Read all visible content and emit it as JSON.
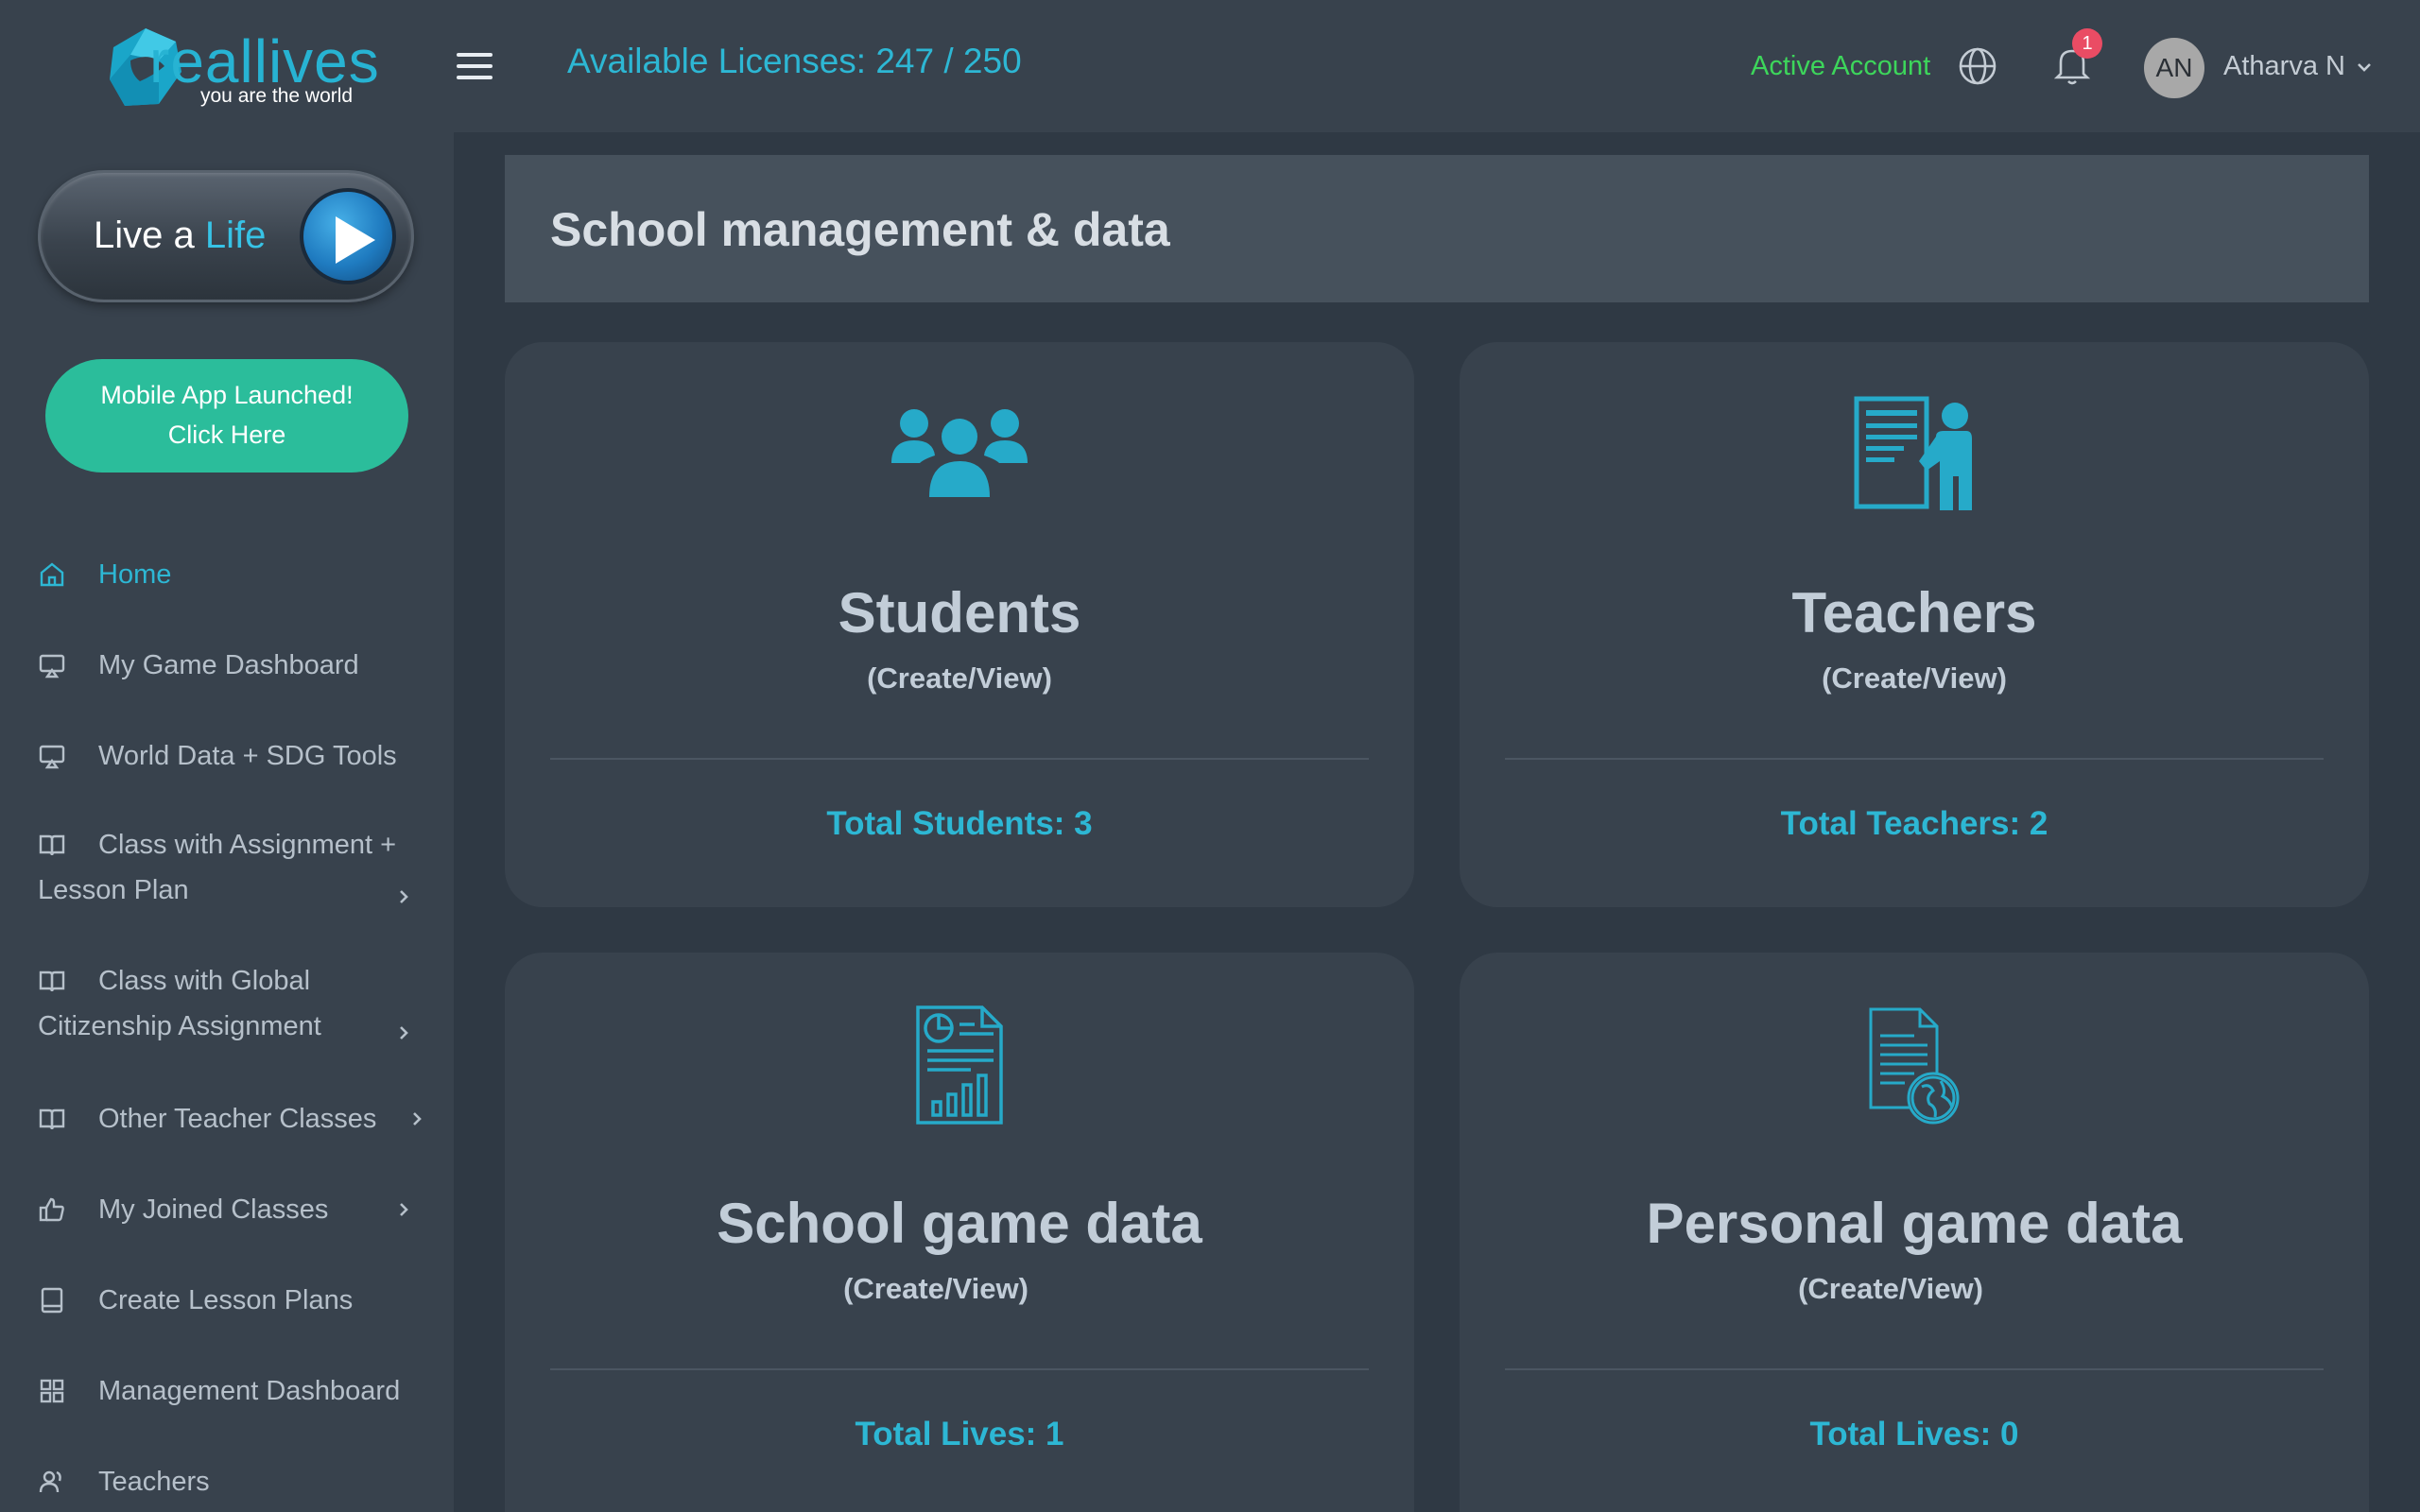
{
  "brand": {
    "name": "reallives",
    "tagline": "you are the world",
    "accent": "#27b3d3"
  },
  "sidebar": {
    "live_button": {
      "prefix": "Live a ",
      "accent_word": "Life"
    },
    "mobile_button": {
      "line1": "Mobile App Launched!",
      "line2": "Click Here"
    },
    "items": [
      {
        "label": "Home",
        "icon": "home-icon",
        "active": true,
        "has_submenu": false
      },
      {
        "label": "My Game Dashboard",
        "icon": "monitor-icon",
        "active": false,
        "has_submenu": false
      },
      {
        "label": "World Data + SDG Tools",
        "icon": "monitor-icon",
        "active": false,
        "has_submenu": false
      },
      {
        "label": "Class with Assignment + Lesson Plan",
        "icon": "book-icon",
        "active": false,
        "has_submenu": true
      },
      {
        "label": "Class with Global Citizenship Assignment",
        "icon": "book-icon",
        "active": false,
        "has_submenu": true
      },
      {
        "label": "Other Teacher Classes",
        "icon": "book-icon",
        "active": false,
        "has_submenu": true
      },
      {
        "label": "My Joined Classes",
        "icon": "thumbs-up-icon",
        "active": false,
        "has_submenu": true
      },
      {
        "label": "Create Lesson Plans",
        "icon": "notebook-icon",
        "active": false,
        "has_submenu": false
      },
      {
        "label": "Management Dashboard",
        "icon": "grid-icon",
        "active": false,
        "has_submenu": false
      },
      {
        "label": "Teachers",
        "icon": "users-icon",
        "active": false,
        "has_submenu": false
      }
    ]
  },
  "header": {
    "licenses": "Available Licenses: 247 / 250",
    "account_status": "Active Account",
    "notification_count": "1",
    "avatar_initials": "AN",
    "user_name": "Atharva N",
    "account_status_color": "#3dd65b",
    "badge_color": "#ea4c64"
  },
  "main": {
    "section_title": "School management & data",
    "cards": [
      {
        "icon": "students-group-icon",
        "title": "Students",
        "subtitle": "(Create/View)",
        "stat": "Total Students: 3"
      },
      {
        "icon": "teacher-board-icon",
        "title": "Teachers",
        "subtitle": "(Create/View)",
        "stat": "Total Teachers: 2"
      },
      {
        "icon": "report-chart-icon",
        "title": "School game data",
        "subtitle": "(Create/View)",
        "stat": "Total Lives: 1"
      },
      {
        "icon": "document-globe-icon",
        "title": "Personal game data",
        "subtitle": "(Create/View)",
        "stat": "Total Lives: 0"
      }
    ]
  }
}
